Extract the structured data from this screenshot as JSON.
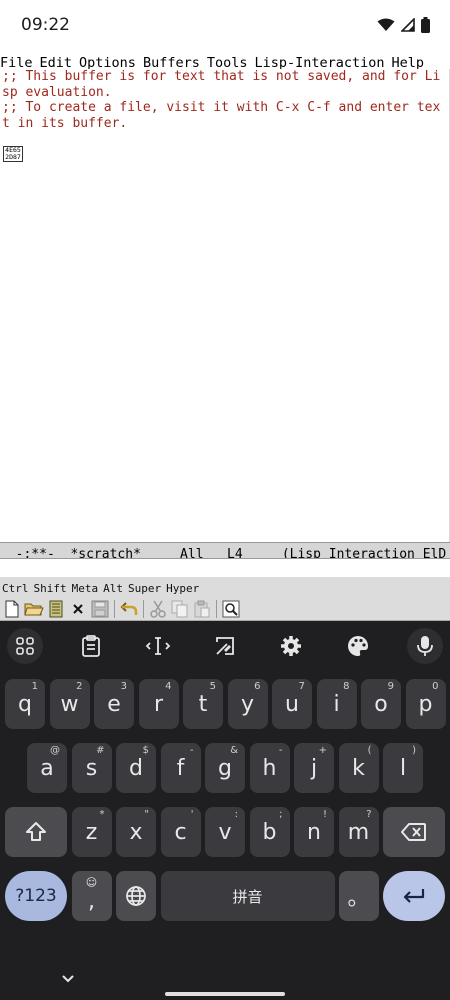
{
  "status": {
    "time": "09:22"
  },
  "menu": [
    "File",
    "Edit",
    "Options",
    "Buffers",
    "Tools",
    "Lisp-Interaction",
    "Help"
  ],
  "editor": {
    "lines": [
      ";; This buffer is for text that is not saved, and for Li",
      "sp evaluation.",
      ";; To create a file, visit it with C-x C-f and enter tex",
      "t in its buffer."
    ],
    "glyph_top": "4E65",
    "glyph_bottom": "2D87"
  },
  "modeline": {
    "status": "-:**-",
    "buffer": "*scratch*",
    "position": "All",
    "line": "L4",
    "mode": "(Lisp Interaction ElD"
  },
  "modifiers": [
    "Ctrl",
    "Shift",
    "Meta",
    "Alt",
    "Super",
    "Hyper"
  ],
  "toolbar_icons": [
    "new-file-icon",
    "open-folder-icon",
    "dired-icon",
    "close-buffer-icon",
    "save-icon",
    "undo-icon",
    "cut-icon",
    "copy-icon",
    "paste-icon",
    "search-icon"
  ],
  "keyboard": {
    "row1": [
      {
        "key": "q",
        "hint": "1"
      },
      {
        "key": "w",
        "hint": "2"
      },
      {
        "key": "e",
        "hint": "3"
      },
      {
        "key": "r",
        "hint": "4"
      },
      {
        "key": "t",
        "hint": "5"
      },
      {
        "key": "y",
        "hint": "6"
      },
      {
        "key": "u",
        "hint": "7"
      },
      {
        "key": "i",
        "hint": "8"
      },
      {
        "key": "o",
        "hint": "9"
      },
      {
        "key": "p",
        "hint": "0"
      }
    ],
    "row2": [
      {
        "key": "a",
        "hint": "@"
      },
      {
        "key": "s",
        "hint": "#"
      },
      {
        "key": "d",
        "hint": "$"
      },
      {
        "key": "f",
        "hint": "-"
      },
      {
        "key": "g",
        "hint": "&"
      },
      {
        "key": "h",
        "hint": "-"
      },
      {
        "key": "j",
        "hint": "+"
      },
      {
        "key": "k",
        "hint": "("
      },
      {
        "key": "l",
        "hint": ")"
      }
    ],
    "row3": [
      {
        "key": "z",
        "hint": "*"
      },
      {
        "key": "x",
        "hint": "\""
      },
      {
        "key": "c",
        "hint": "'"
      },
      {
        "key": "v",
        "hint": ":"
      },
      {
        "key": "b",
        "hint": ";"
      },
      {
        "key": "n",
        "hint": "!"
      },
      {
        "key": "m",
        "hint": "?"
      }
    ],
    "symbols_label": "?123",
    "comma": ",",
    "space_label": "拼音",
    "period": "。"
  }
}
